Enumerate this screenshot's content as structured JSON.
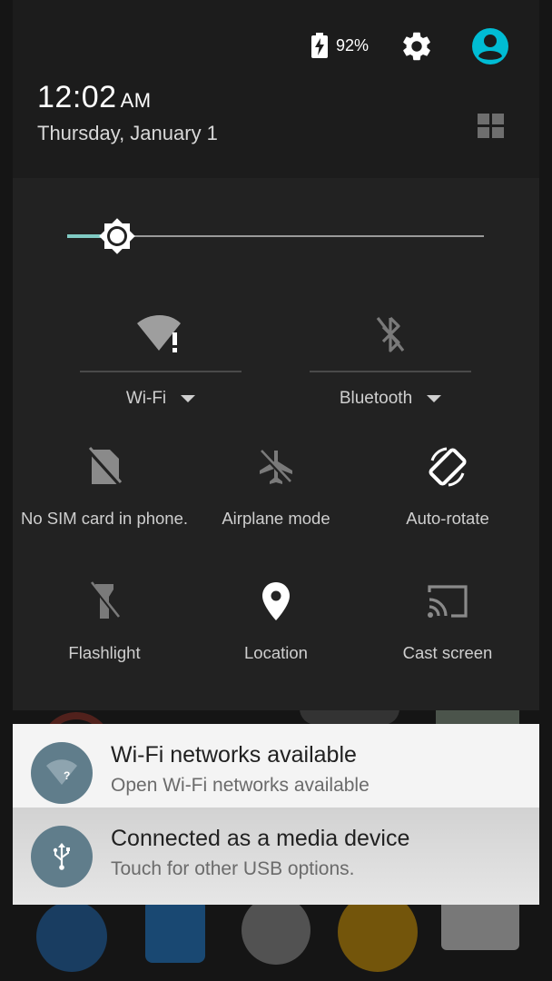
{
  "status": {
    "battery_percent": "92%",
    "time": "12:02",
    "ampm": "AM",
    "date": "Thursday, January 1"
  },
  "brightness": {
    "level": 0.12
  },
  "toggles": {
    "wifi": {
      "label": "Wi-Fi",
      "icon": "wifi-alert-icon"
    },
    "bluetooth": {
      "label": "Bluetooth",
      "icon": "bluetooth-off-icon"
    }
  },
  "tiles": [
    {
      "label": "No SIM card in phone.",
      "icon": "no-sim-icon"
    },
    {
      "label": "Airplane mode",
      "icon": "airplane-off-icon"
    },
    {
      "label": "Auto-rotate",
      "icon": "auto-rotate-icon"
    },
    {
      "label": "Flashlight",
      "icon": "flashlight-off-icon"
    },
    {
      "label": "Location",
      "icon": "location-pin-icon"
    },
    {
      "label": "Cast screen",
      "icon": "cast-icon"
    }
  ],
  "notifications": [
    {
      "title": "Wi-Fi networks available",
      "subtitle": "Open Wi-Fi networks available",
      "icon": "wifi-question-icon"
    },
    {
      "title": "Connected as a media device",
      "subtitle": "Touch for other USB options.",
      "icon": "usb-icon"
    }
  ],
  "colors": {
    "accent": "#80cbc4",
    "avatar": "#00bcd4",
    "notification_icon_bg": "#607d8b"
  }
}
